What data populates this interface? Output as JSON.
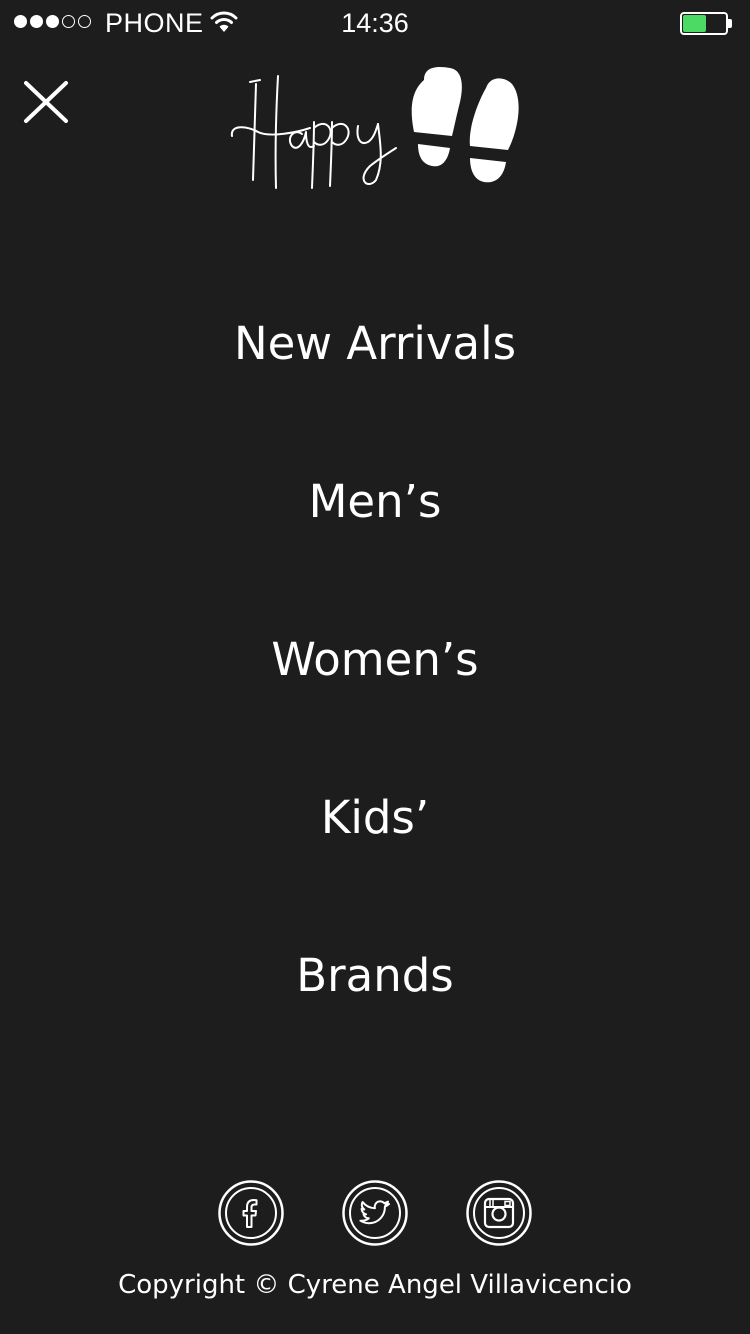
{
  "status_bar": {
    "carrier": "PHONE",
    "time": "14:36",
    "signal_bars_filled": 3,
    "signal_bars_total": 5,
    "battery_level": 0.55,
    "battery_color": "#4cd964"
  },
  "header": {
    "close_icon": "close-icon",
    "logo_text": "Happy",
    "logo_icon": "footprints-icon"
  },
  "menu": {
    "items": [
      {
        "label": "New Arrivals"
      },
      {
        "label": "Men’s"
      },
      {
        "label": "Women’s"
      },
      {
        "label": "Kids’"
      },
      {
        "label": "Brands"
      }
    ]
  },
  "social": {
    "links": [
      {
        "name": "facebook",
        "icon": "facebook-icon"
      },
      {
        "name": "twitter",
        "icon": "twitter-icon"
      },
      {
        "name": "instagram",
        "icon": "instagram-icon"
      }
    ]
  },
  "footer": {
    "copyright": "Copyright © Cyrene Angel Villavicencio"
  },
  "colors": {
    "background": "#1d1d1d",
    "text": "#ffffff",
    "battery": "#4cd964"
  }
}
